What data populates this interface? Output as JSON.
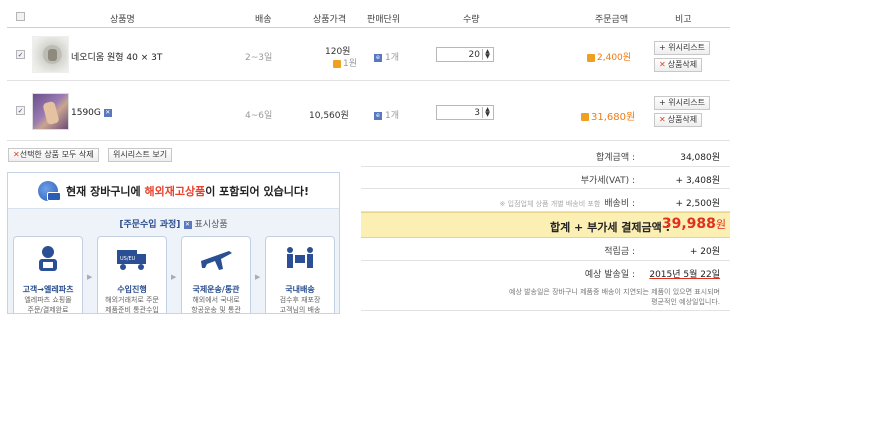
{
  "headers": {
    "product": "상품명",
    "shipping": "배송",
    "price": "상품가격",
    "unit": "판매단위",
    "qty": "수량",
    "amount": "주문금액",
    "note": "비고"
  },
  "items": [
    {
      "name": "네오디움 원형 40 × 3T",
      "shipping": "2~3일",
      "price": "120원",
      "points": "1원",
      "unit": "1개",
      "qty": "20",
      "amount": "2,400원",
      "btn_wishlist": "+ 위시리스트",
      "btn_delete": "상품삭제"
    },
    {
      "name": "1590G",
      "shipping": "4~6일",
      "price": "10,560원",
      "unit": "1개",
      "qty": "3",
      "amount": "31,680원",
      "btn_wishlist": "+ 위시리스트",
      "btn_delete": "상품삭제"
    }
  ],
  "actions": {
    "delete_selected": "선택한 상품 모두 삭제",
    "view_wishlist": "위시리스트 보기"
  },
  "notice": {
    "title_prefix": "현재 장바구니에 ",
    "title_highlight": "해외재고상품",
    "title_suffix": "이 포함되어 있습니다!",
    "process_title": "[주문수입 과정]",
    "process_legend": "표시상품",
    "steps": [
      {
        "label": "고객→엘레파츠",
        "desc": "엘레파츠 쇼핑몰\n주문/결제완료"
      },
      {
        "label": "수입진행",
        "desc": "해외거래처로 주문\n제품준비 통관수입"
      },
      {
        "label": "국제운송/통관",
        "desc": "해외에서 국내로\n항공운송 및 통관"
      },
      {
        "label": "국내배송",
        "desc": "검수후 재포장\n고객님의 배송"
      }
    ]
  },
  "totals": {
    "sum_label": "합계금액 :",
    "sum_value": "34,080원",
    "vat_label": "부가세(VAT) :",
    "vat_value": "+ 3,408원",
    "ship_note": "※ 입점업체 상품 개별 배송비 포함",
    "ship_label": "배송비 :",
    "ship_value": "+ 2,500원",
    "grand_label": "합계 + 부가세 결제금액 :",
    "grand_value": "39,988",
    "grand_unit": "원",
    "points_label": "적립금 :",
    "points_value": "+ 20원",
    "date_label": "예상 발송일 :",
    "date_value": "2015년 5월 22일",
    "date_note_1": "예상 발송일은 장바구니 제품중 배송이 지연되는 제품이 있으면 표시되며",
    "date_note_2": "평균적인 예상일입니다."
  }
}
